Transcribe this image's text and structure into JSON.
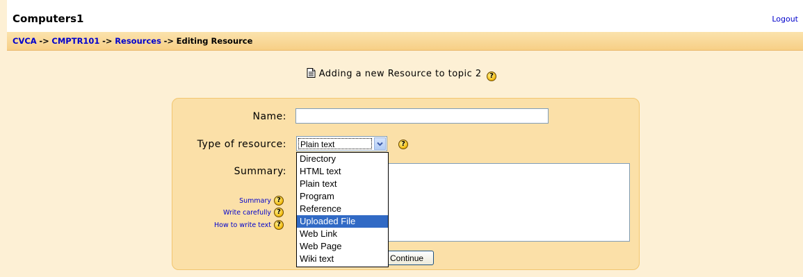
{
  "site": {
    "title": "Computers1",
    "logout_label": "Logout"
  },
  "breadcrumb": {
    "items": [
      "CVCA",
      "CMPTR101",
      "Resources"
    ],
    "separator": "->",
    "current": "Editing Resource"
  },
  "heading": {
    "text": "Adding a new Resource to topic 2"
  },
  "form": {
    "name_label": "Name:",
    "name_value": "",
    "type_label": "Type of resource:",
    "type_selected": "Plain text",
    "type_options": [
      "Directory",
      "HTML text",
      "Plain text",
      "Program",
      "Reference",
      "Uploaded File",
      "Web Link",
      "Web Page",
      "Wiki text"
    ],
    "highlighted_option": "Uploaded File",
    "summary_label": "Summary:",
    "help_links": [
      "Summary",
      "Write carefully",
      "How to write text"
    ],
    "continue_label": "Continue"
  },
  "colors": {
    "accent": "#316ac5",
    "link": "#0000cc",
    "navbar": "#f7cf86",
    "background": "#fdf0d5"
  },
  "icons": {
    "help": "help-icon",
    "document": "document-icon",
    "dropdown": "chevron-down-icon"
  }
}
